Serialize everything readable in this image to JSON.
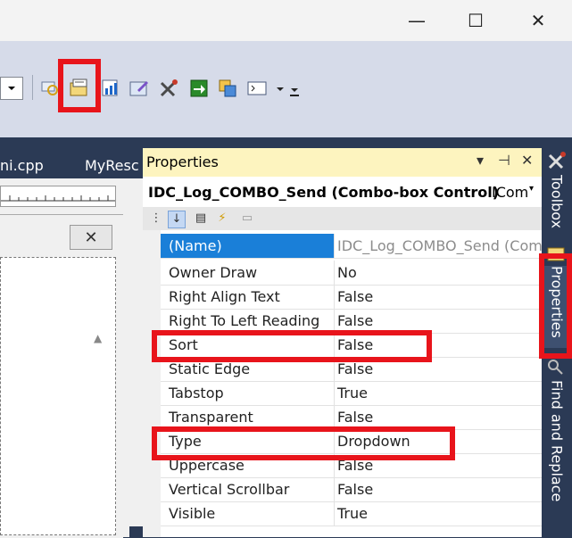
{
  "window": {
    "minimize": "—",
    "maximize": "☐",
    "close": "✕"
  },
  "tabs": {
    "left_tab": "ni.cpp",
    "right_tab": "MyResc"
  },
  "properties": {
    "title": "Properties",
    "object_name": "IDC_Log_COMBO_Send (Combo-box Control)",
    "object_type": "ICom",
    "rows": [
      {
        "name": "(Name)",
        "value": "IDC_Log_COMBO_Send (Com"
      },
      {
        "name": "Owner Draw",
        "value": "No"
      },
      {
        "name": "Right Align Text",
        "value": "False"
      },
      {
        "name": "Right To Left Reading",
        "value": "False"
      },
      {
        "name": "Sort",
        "value": "False"
      },
      {
        "name": "Static Edge",
        "value": "False"
      },
      {
        "name": "Tabstop",
        "value": "True"
      },
      {
        "name": "Transparent",
        "value": "False"
      },
      {
        "name": "Type",
        "value": "Dropdown"
      },
      {
        "name": "Uppercase",
        "value": "False"
      },
      {
        "name": "Vertical Scrollbar",
        "value": "False"
      },
      {
        "name": "Visible",
        "value": "True"
      }
    ]
  },
  "side_tabs": {
    "toolbox": "Toolbox",
    "properties": "Properties",
    "find": "Find and Replace"
  },
  "colors": {
    "accent": "#e8141b",
    "selection": "#1a7fd8",
    "title_bar": "#fdf4bf",
    "ide_dark": "#2b3a55"
  }
}
